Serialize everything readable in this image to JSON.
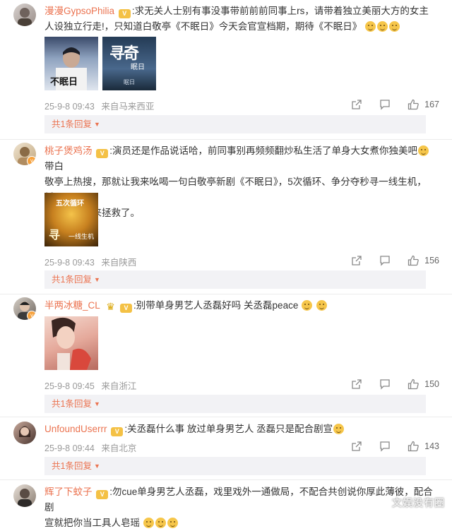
{
  "comments": [
    {
      "user": "漫漫GypsoPhilia",
      "text_line1": "求无关人士别有事没事带前前前同事上rs，请带着独立美丽大方的女主",
      "text_line2": "人设独立行走!，只知道白敬亭《不眠日》今天会官宣档期，期待《不眠日》",
      "time": "25-9-8 09:43",
      "location": "来自马来西亚",
      "likes": "167",
      "replies": "共1条回复",
      "image_texts": [
        "不眠日",
        "寻奇",
        "眠日"
      ]
    },
    {
      "user": "桃子煲鸡汤",
      "text_line1": "演员还是作品说话哈，前同事别再频频翻炒私生活了单身大女煮你独美吧",
      "text_line1b": "带白",
      "text_line2": "敬亭上热搜，那就让我来吆喝一句白敬亭新剧《不眠日》，5次循环、争分夺秒寻一线生机，循",
      "text_line3": "环的神他又来拯救了。",
      "time": "25-9-8 09:43",
      "location": "来自陕西",
      "likes": "156",
      "replies": "共1条回复",
      "image_texts": [
        "五次循环",
        "寻",
        "一线生机"
      ]
    },
    {
      "user": "半两冰糖_CL",
      "text_line1": "别带单身男艺人丞磊好吗 关丞磊peace",
      "time": "25-9-8 09:45",
      "location": "来自浙江",
      "likes": "150",
      "replies": "共1条回复"
    },
    {
      "user": "UnfoundUserrr",
      "text_line1": "关丞磊什么事 放过单身男艺人 丞磊只是配合剧宣",
      "time": "25-9-8 09:44",
      "location": "来自北京",
      "likes": "143",
      "replies": "共1条回复"
    },
    {
      "user": "辉了下蚊子",
      "text_line1": "勿cue单身男艺人丞磊，戏里戏外一通做局，不配合共创说你厚此薄彼，配合剧",
      "text_line2": "宣就把你当工具人皂瑶"
    }
  ],
  "watermark": "文娱没有圈",
  "colors": {
    "username": "#eb7350",
    "meta": "#999999",
    "reply_bg": "#f2f2f5",
    "divider": "#ececec"
  },
  "icons": [
    "share-icon",
    "comment-icon",
    "like-icon",
    "chevron-down-icon",
    "vip-badge-icon",
    "verified-badge-icon"
  ]
}
